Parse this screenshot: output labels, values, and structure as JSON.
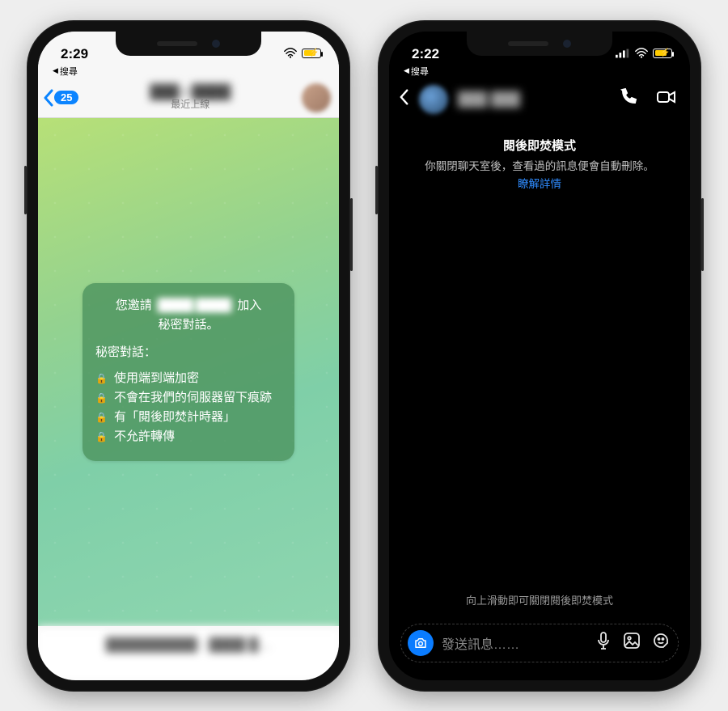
{
  "left": {
    "status_time": "2:29",
    "breadcrumb": "搜尋",
    "back_badge": "25",
    "contact_name": "███ ▪ ████",
    "contact_status": "最近上線",
    "card": {
      "invite_prefix": "您邀請",
      "invite_name": "████ ████",
      "invite_suffix": "加入",
      "invite_line2": "秘密對話。",
      "section_label": "秘密對話：",
      "bullets": [
        "使用端到端加密",
        "不會在我們的伺服器留下痕跡",
        "有「閱後即焚計時器」",
        "不允許轉傳"
      ]
    },
    "input_placeholder": "██████████ - ████ █…"
  },
  "right": {
    "status_time": "2:22",
    "breadcrumb": "搜尋",
    "contact_name": "███ ███",
    "mode_title": "閱後即焚模式",
    "mode_desc": "你關閉聊天室後，查看過的訊息便會自動刪除。",
    "mode_link": "瞭解詳情",
    "swipe_hint": "向上滑動即可關閉閱後即焚模式",
    "input_placeholder": "發送訊息……"
  }
}
